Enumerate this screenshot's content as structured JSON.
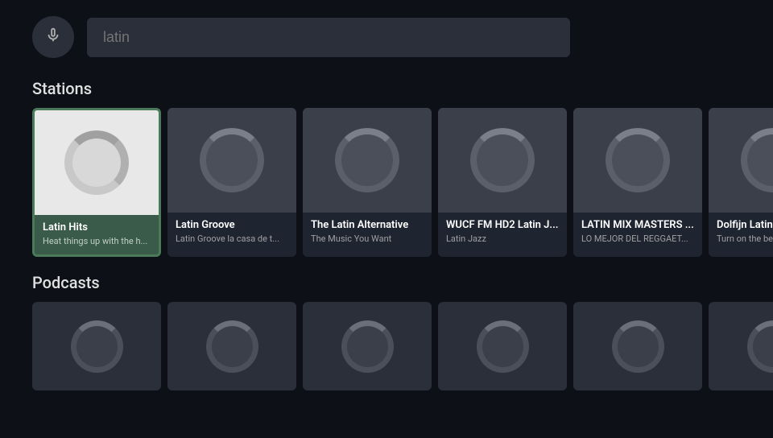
{
  "header": {
    "mic_label": "🎤",
    "search_placeholder": "latin",
    "search_value": "latin"
  },
  "stations_section": {
    "title": "Stations",
    "cards": [
      {
        "name": "Latin Hits",
        "description": "Heat things up with the h...",
        "focused": true
      },
      {
        "name": "Latin Groove",
        "description": "Latin Groove la casa de t...",
        "focused": false
      },
      {
        "name": "The Latin Alternative",
        "description": "The Music You Want",
        "focused": false
      },
      {
        "name": "WUCF FM HD2 Latin J...",
        "description": "Latin Jazz",
        "focused": false
      },
      {
        "name": "LATIN MIX MASTERS ...",
        "description": "LO MEJOR DEL REGGAET...",
        "focused": false
      },
      {
        "name": "Dolfijn Latin",
        "description": "Turn on the beach",
        "focused": false
      }
    ]
  },
  "podcasts_section": {
    "title": "Podcasts",
    "cards": [
      {},
      {},
      {},
      {},
      {},
      {}
    ]
  }
}
